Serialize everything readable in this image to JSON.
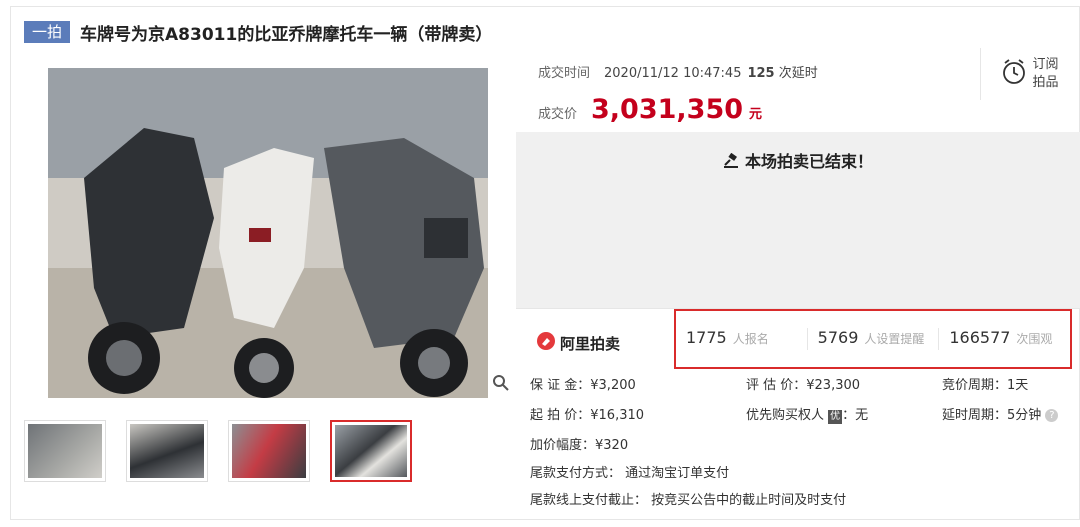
{
  "header": {
    "badge": "一拍",
    "title": "车牌号为京A83011的比亚乔牌摩托车一辆（带牌卖）"
  },
  "deal": {
    "time_label": "成交时间",
    "time_value": "2020/11/12 10:47:45",
    "delays": "125",
    "delays_label": "次延时",
    "price_label": "成交价",
    "price": "3,031,350",
    "price_unit": "元"
  },
  "subscribe": {
    "line1": "订阅",
    "line2": "拍品"
  },
  "status": {
    "ended": "本场拍卖已结束！"
  },
  "brand": {
    "name": "阿里拍卖"
  },
  "stats": [
    {
      "num": "1775",
      "unit": "人报名"
    },
    {
      "num": "5769",
      "unit": "人设置提醒"
    },
    {
      "num": "166577",
      "unit": "次围观"
    }
  ],
  "details": {
    "deposit": "保 证 金：¥3,200",
    "appraisal": "评 估 价：¥23,300",
    "cycle": "竞价周期：1天",
    "start_price": "起 拍 价：¥16,310",
    "priority": "优先购买权人",
    "priority_badge": "优",
    "priority_value": "：无",
    "delay_cycle": "延时周期：5分钟",
    "increment": "加价幅度：¥320",
    "pay_method": "尾款支付方式：  通过淘宝订单支付",
    "pay_deadline": "尾款线上支付截止：  按竞买公告中的截止时间及时支付"
  }
}
